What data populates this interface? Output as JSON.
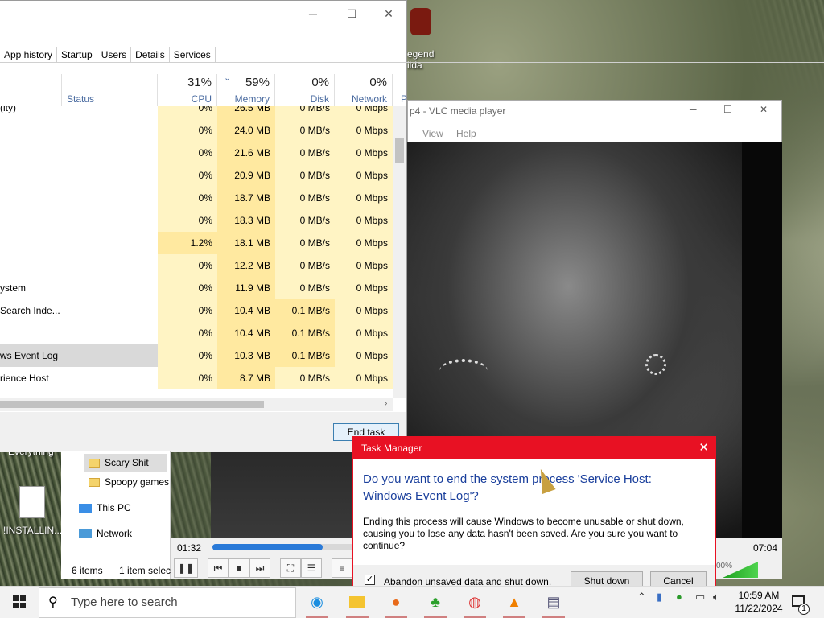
{
  "desktop": {
    "icon_top_label_1": "egend",
    "icon_top_label_2": "ilda",
    "icon_everything": "Everything",
    "icon_installing": "!INSTALLIN..."
  },
  "task_manager": {
    "tabs": [
      "App history",
      "Startup",
      "Users",
      "Details",
      "Services",
      "P"
    ],
    "headers": {
      "status": "Status",
      "cpu_pct": "31%",
      "cpu": "CPU",
      "mem_pct": "59%",
      "mem": "Memory",
      "disk_pct": "0%",
      "disk": "Disk",
      "net_pct": "0%",
      "net": "Network"
    },
    "rows": [
      {
        "name": "(ity)",
        "cpu": "0%",
        "mem": "26.5 MB",
        "disk": "0 MB/s",
        "net": "0 Mbps"
      },
      {
        "name": "",
        "cpu": "0%",
        "mem": "24.0 MB",
        "disk": "0 MB/s",
        "net": "0 Mbps"
      },
      {
        "name": "",
        "cpu": "0%",
        "mem": "21.6 MB",
        "disk": "0 MB/s",
        "net": "0 Mbps"
      },
      {
        "name": "",
        "cpu": "0%",
        "mem": "20.9 MB",
        "disk": "0 MB/s",
        "net": "0 Mbps"
      },
      {
        "name": "",
        "cpu": "0%",
        "mem": "18.7 MB",
        "disk": "0 MB/s",
        "net": "0 Mbps"
      },
      {
        "name": "",
        "cpu": "0%",
        "mem": "18.3 MB",
        "disk": "0 MB/s",
        "net": "0 Mbps"
      },
      {
        "name": "",
        "cpu": "1.2%",
        "mem": "18.1 MB",
        "disk": "0 MB/s",
        "net": "0 Mbps"
      },
      {
        "name": "",
        "cpu": "0%",
        "mem": "12.2 MB",
        "disk": "0 MB/s",
        "net": "0 Mbps"
      },
      {
        "name": "ystem",
        "cpu": "0%",
        "mem": "11.9 MB",
        "disk": "0 MB/s",
        "net": "0 Mbps"
      },
      {
        "name": "Search Inde...",
        "cpu": "0%",
        "mem": "10.4 MB",
        "disk": "0.1 MB/s",
        "net": "0 Mbps"
      },
      {
        "name": "",
        "cpu": "0%",
        "mem": "10.4 MB",
        "disk": "0.1 MB/s",
        "net": "0 Mbps"
      },
      {
        "name": "ws Event Log",
        "cpu": "0%",
        "mem": "10.3 MB",
        "disk": "0.1 MB/s",
        "net": "0 Mbps"
      },
      {
        "name": "rience Host",
        "cpu": "0%",
        "mem": "8.7 MB",
        "disk": "0 MB/s",
        "net": "0 Mbps"
      }
    ],
    "end_task": "End task"
  },
  "vlc": {
    "title": "p4 - VLC media player",
    "menu": [
      "View",
      "Help"
    ],
    "elapsed": "01:32",
    "duration": "07:04",
    "volume_label": "00%",
    "seek_fraction": 0.22
  },
  "explorer": {
    "items": [
      "Scary Shit",
      "Spoopy games",
      "This PC",
      "Network"
    ],
    "status_count": "6 items",
    "status_selected": "1 item select"
  },
  "dialog": {
    "title": "Task Manager",
    "heading": "Do you want to end the system process 'Service Host: Windows Event Log'?",
    "body": "Ending this process will cause Windows to become unusable or shut down, causing you to lose any data hasn't been saved. Are you sure you want to continue?",
    "checkbox_label": "Abandon unsaved data and shut down.",
    "shutdown": "Shut down",
    "cancel": "Cancel"
  },
  "taskbar": {
    "search_placeholder": "Type here to search",
    "time": "10:59 AM",
    "date": "11/22/2024",
    "notification_count": "1"
  }
}
